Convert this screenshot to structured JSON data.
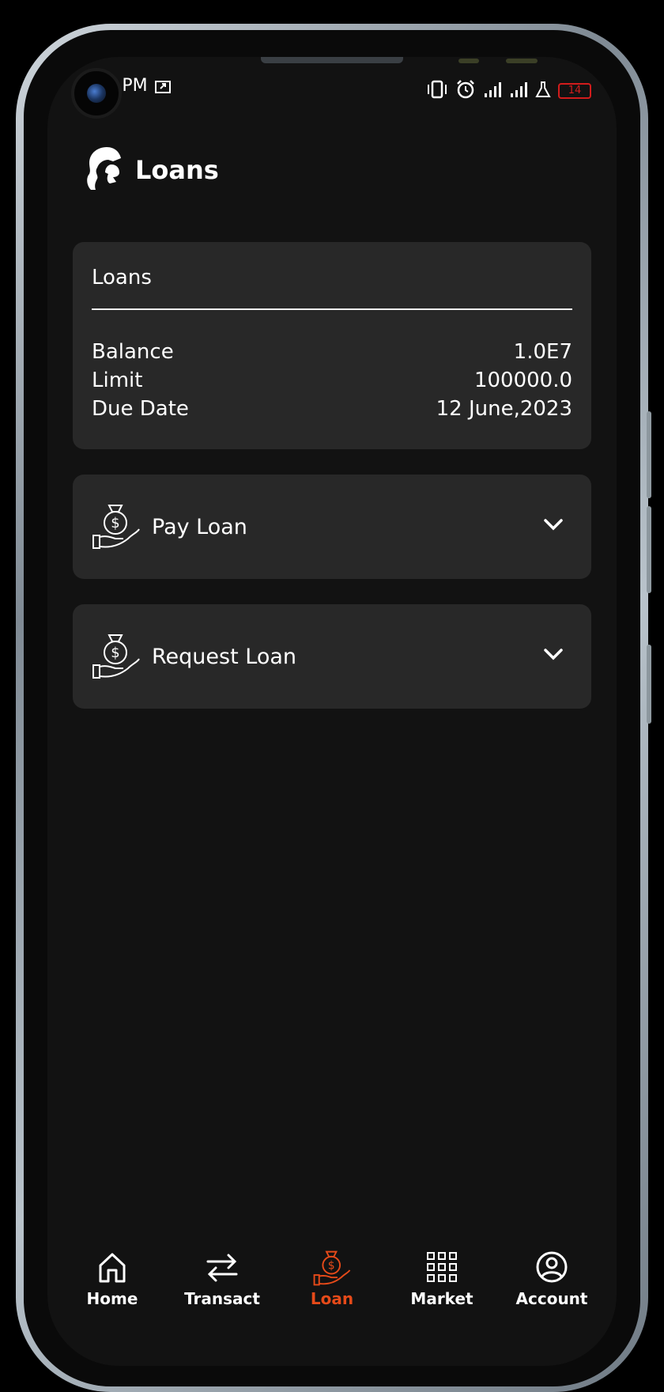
{
  "status_bar": {
    "time": "5:11 PM",
    "battery": "14",
    "battery_color": "#d21c1c"
  },
  "header": {
    "title": "Loans",
    "logo_icon": "head-silhouette-icon"
  },
  "summary": {
    "title": "Loans",
    "rows": [
      {
        "label": "Balance",
        "value": "1.0E7"
      },
      {
        "label": "Limit",
        "value": "100000.0"
      },
      {
        "label": "Due Date",
        "value": "12 June,2023"
      }
    ]
  },
  "actions": [
    {
      "label": "Pay Loan",
      "icon": "money-bag-hand-icon"
    },
    {
      "label": "Request Loan",
      "icon": "money-bag-hand-icon"
    }
  ],
  "bottom_nav": {
    "active_color": "#e64a19",
    "items": [
      {
        "label": "Home",
        "icon": "home-icon"
      },
      {
        "label": "Transact",
        "icon": "swap-arrows-icon"
      },
      {
        "label": "Loan",
        "icon": "money-bag-hand-icon"
      },
      {
        "label": "Market",
        "icon": "grid-icon"
      },
      {
        "label": "Account",
        "icon": "user-circle-icon"
      }
    ]
  }
}
